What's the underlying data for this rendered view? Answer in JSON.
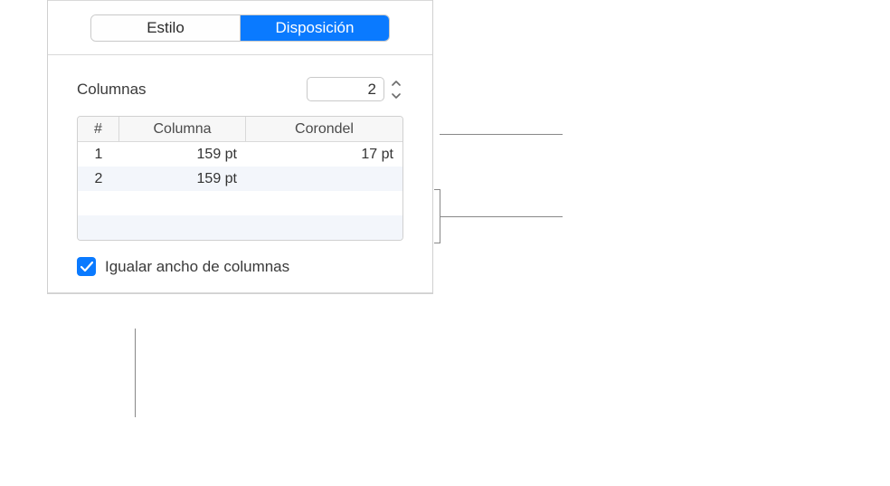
{
  "tabs": {
    "style": "Estilo",
    "layout": "Disposición"
  },
  "columns": {
    "label": "Columnas",
    "value": "2",
    "headers": {
      "num": "#",
      "column": "Columna",
      "gutter": "Corondel"
    },
    "rows": [
      {
        "num": "1",
        "column": "159 pt",
        "gutter": "17 pt"
      },
      {
        "num": "2",
        "column": "159 pt",
        "gutter": ""
      }
    ],
    "equalWidth": "Igualar ancho de columnas"
  }
}
